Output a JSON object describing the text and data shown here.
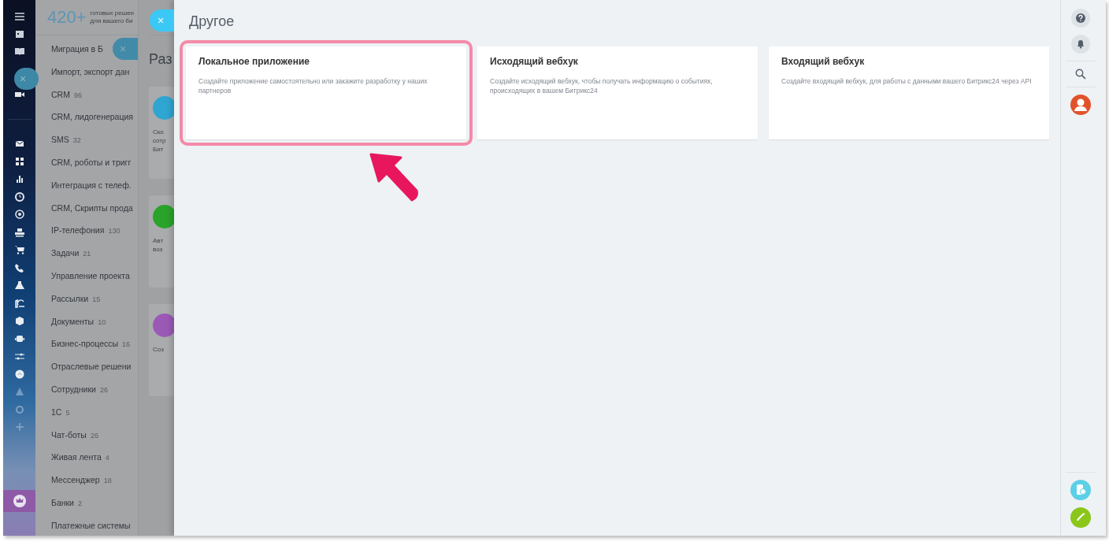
{
  "catalog": {
    "count": "420+",
    "tagline": [
      "готовых решен",
      "для вашего би"
    ],
    "categories": [
      {
        "label": "Миграция в Б"
      },
      {
        "label": "Импорт, экспорт дан"
      },
      {
        "label": "CRM",
        "count": "96"
      },
      {
        "label": "CRM, лидогенерация"
      },
      {
        "label": "SMS",
        "count": "32"
      },
      {
        "label": "CRM, роботы и тригг"
      },
      {
        "label": "Интеграция с телеф."
      },
      {
        "label": "CRM, Скрипты прода"
      },
      {
        "label": "IP-телефония",
        "count": "130"
      },
      {
        "label": "Задачи",
        "count": "21"
      },
      {
        "label": "Управление проекта"
      },
      {
        "label": "Рассылки",
        "count": "15"
      },
      {
        "label": "Документы",
        "count": "10"
      },
      {
        "label": "Бизнес-процессы",
        "count": "16"
      },
      {
        "label": "Отраслевые решени"
      },
      {
        "label": "Сотрудники",
        "count": "26"
      },
      {
        "label": "1С",
        "count": "5"
      },
      {
        "label": "Чат-боты",
        "count": "26"
      },
      {
        "label": "Живая лента",
        "count": "4"
      },
      {
        "label": "Мессенджер",
        "count": "18"
      },
      {
        "label": "Банки",
        "count": "2"
      },
      {
        "label": "Платежные системы"
      }
    ]
  },
  "close_buttons": [
    "×",
    "×",
    "×"
  ],
  "background_page": {
    "heading": "Раз",
    "cards": [
      {
        "color": "#2fa5d1",
        "lines": [
          "Ско",
          "сотр",
          "Бит"
        ]
      },
      {
        "color": "#29a329",
        "lines": [
          "Авт",
          "воз"
        ]
      },
      {
        "color": "#9b59b6",
        "lines": [
          "Соз"
        ]
      }
    ]
  },
  "slider": {
    "title": "Другое",
    "cards": [
      {
        "title": "Локальное приложение",
        "description": "Создайте приложение самостоятельно или закажите разработку у наших партнеров",
        "selected": true
      },
      {
        "title": "Исходящий вебхук",
        "description": "Создайте исходящий вебхук, чтобы получать информацию о событиях, происходящих в вашем Битрикс24",
        "selected": false
      },
      {
        "title": "Входящий вебхук",
        "description": "Создайте входящий вебхук, для работы с данными вашего Битрикс24 через API",
        "selected": false
      }
    ]
  }
}
